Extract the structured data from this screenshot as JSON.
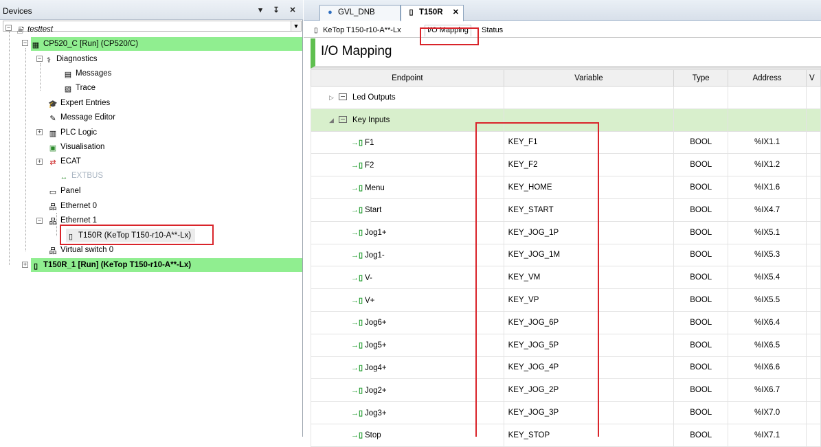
{
  "left_panel": {
    "title": "Devices",
    "pin_glyph": "↓",
    "dock_glyph": "↧",
    "close_glyph": "✕"
  },
  "tree": {
    "root": "testtest",
    "controller": "CP520_C [Run] (CP520/C)",
    "diagnostics": "Diagnostics",
    "messages": "Messages",
    "trace": "Trace",
    "expert_entries": "Expert Entries",
    "message_editor": "Message Editor",
    "plc_logic": "PLC Logic",
    "visualisation": "Visualisation",
    "ecat": "ECAT",
    "extbus": "EXTBUS",
    "panel": "Panel",
    "ethernet0": "Ethernet 0",
    "ethernet1": "Ethernet 1",
    "t150r": "T150R (KeTop T150-r10-A**-Lx)",
    "virtual_switch": "Virtual switch 0",
    "t150r_1": "T150R_1 [Run] (KeTop T150-r10-A**-Lx)"
  },
  "doc_tabs": [
    {
      "label": "GVL_DNB"
    },
    {
      "label": "T150R",
      "close": "✕"
    }
  ],
  "sub_tabs": [
    "KeTop T150-r10-A**-Lx",
    "I/O Mapping",
    "Status"
  ],
  "panel_title": "I/O Mapping",
  "table": {
    "headers": [
      "Endpoint",
      "Variable",
      "Type",
      "Address",
      "V"
    ],
    "groups": [
      "Led Outputs",
      "Key Inputs"
    ],
    "rows": [
      {
        "endpoint": "F1",
        "variable": "KEY_F1",
        "type": "BOOL",
        "address": "%IX1.1"
      },
      {
        "endpoint": "F2",
        "variable": "KEY_F2",
        "type": "BOOL",
        "address": "%IX1.2"
      },
      {
        "endpoint": "Menu",
        "variable": "KEY_HOME",
        "type": "BOOL",
        "address": "%IX1.6"
      },
      {
        "endpoint": "Start",
        "variable": "KEY_START",
        "type": "BOOL",
        "address": "%IX4.7"
      },
      {
        "endpoint": "Jog1+",
        "variable": "KEY_JOG_1P",
        "type": "BOOL",
        "address": "%IX5.1"
      },
      {
        "endpoint": "Jog1-",
        "variable": "KEY_JOG_1M",
        "type": "BOOL",
        "address": "%IX5.3"
      },
      {
        "endpoint": "V-",
        "variable": "KEY_VM",
        "type": "BOOL",
        "address": "%IX5.4"
      },
      {
        "endpoint": "V+",
        "variable": "KEY_VP",
        "type": "BOOL",
        "address": "%IX5.5"
      },
      {
        "endpoint": "Jog6+",
        "variable": "KEY_JOG_6P",
        "type": "BOOL",
        "address": "%IX6.4"
      },
      {
        "endpoint": "Jog5+",
        "variable": "KEY_JOG_5P",
        "type": "BOOL",
        "address": "%IX6.5"
      },
      {
        "endpoint": "Jog4+",
        "variable": "KEY_JOG_4P",
        "type": "BOOL",
        "address": "%IX6.6"
      },
      {
        "endpoint": "Jog2+",
        "variable": "KEY_JOG_2P",
        "type": "BOOL",
        "address": "%IX6.7"
      },
      {
        "endpoint": "Jog3+",
        "variable": "KEY_JOG_3P",
        "type": "BOOL",
        "address": "%IX7.0"
      },
      {
        "endpoint": "Stop",
        "variable": "KEY_STOP",
        "type": "BOOL",
        "address": "%IX7.1"
      }
    ]
  },
  "colors": {
    "running_highlight": "#90ee90",
    "annotation_red": "#d9242a",
    "selected_row": "#d8efcc",
    "header_accent": "#5fbf4f"
  }
}
